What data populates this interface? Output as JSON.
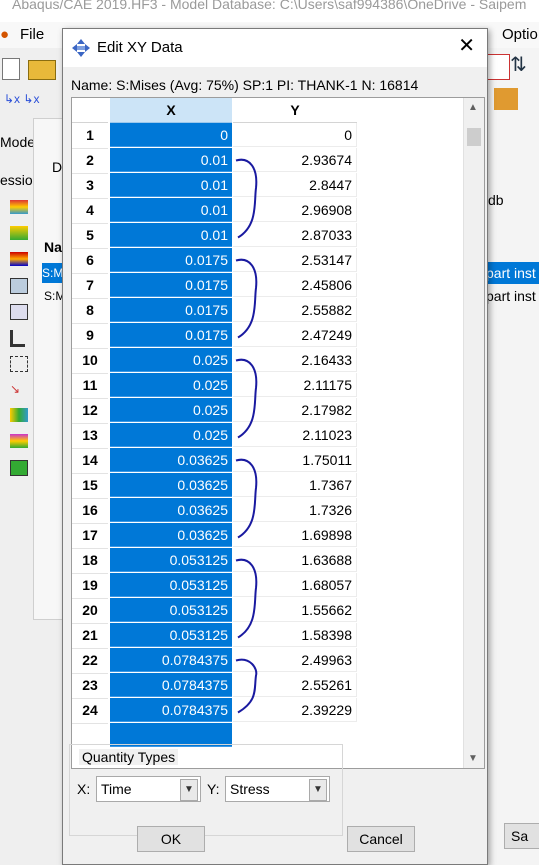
{
  "app": {
    "title": "Abaqus/CAE 2019.HF3 - Model Database: C:\\Users\\saf994386\\OneDrive - Saipem",
    "menu_file": "File",
    "menu_options": "Optio",
    "left_tab_model": "Mode",
    "left_tab_session": "essio",
    "left_panel_letter": "D",
    "list_header": "Na",
    "list_item_1": "S:M",
    "list_item_2": "S:M",
    "right_text_db": "db",
    "right_text_part1": "part inst",
    "right_text_part2": "part inst",
    "bottom_right_button": "Sa"
  },
  "dialog": {
    "title": "Edit XY Data",
    "name_line": "Name: S:Mises (Avg: 75%) SP:1 PI: THANK-1 N: 16814",
    "col_x": "X",
    "col_y": "Y",
    "rows": [
      {
        "n": "1",
        "x": "0",
        "y": "0"
      },
      {
        "n": "2",
        "x": "0.01",
        "y": "2.93674"
      },
      {
        "n": "3",
        "x": "0.01",
        "y": "2.8447"
      },
      {
        "n": "4",
        "x": "0.01",
        "y": "2.96908"
      },
      {
        "n": "5",
        "x": "0.01",
        "y": "2.87033"
      },
      {
        "n": "6",
        "x": "0.0175",
        "y": "2.53147"
      },
      {
        "n": "7",
        "x": "0.0175",
        "y": "2.45806"
      },
      {
        "n": "8",
        "x": "0.0175",
        "y": "2.55882"
      },
      {
        "n": "9",
        "x": "0.0175",
        "y": "2.47249"
      },
      {
        "n": "10",
        "x": "0.025",
        "y": "2.16433"
      },
      {
        "n": "11",
        "x": "0.025",
        "y": "2.11175"
      },
      {
        "n": "12",
        "x": "0.025",
        "y": "2.17982"
      },
      {
        "n": "13",
        "x": "0.025",
        "y": "2.11023"
      },
      {
        "n": "14",
        "x": "0.03625",
        "y": "1.75011"
      },
      {
        "n": "15",
        "x": "0.03625",
        "y": "1.7367"
      },
      {
        "n": "16",
        "x": "0.03625",
        "y": "1.7326"
      },
      {
        "n": "17",
        "x": "0.03625",
        "y": "1.69898"
      },
      {
        "n": "18",
        "x": "0.053125",
        "y": "1.63688"
      },
      {
        "n": "19",
        "x": "0.053125",
        "y": "1.68057"
      },
      {
        "n": "20",
        "x": "0.053125",
        "y": "1.55662"
      },
      {
        "n": "21",
        "x": "0.053125",
        "y": "1.58398"
      },
      {
        "n": "22",
        "x": "0.0784375",
        "y": "2.49963"
      },
      {
        "n": "23",
        "x": "0.0784375",
        "y": "2.55261"
      },
      {
        "n": "24",
        "x": "0.0784375",
        "y": "2.39229"
      }
    ],
    "quantity_types_label": "Quantity Types",
    "x_label": "X:",
    "x_value": "Time",
    "y_label": "Y:",
    "y_value": "Stress",
    "ok_label": "OK",
    "cancel_label": "Cancel",
    "selection_color": "#0078d7",
    "annotation_color": "#1a1aa0"
  }
}
